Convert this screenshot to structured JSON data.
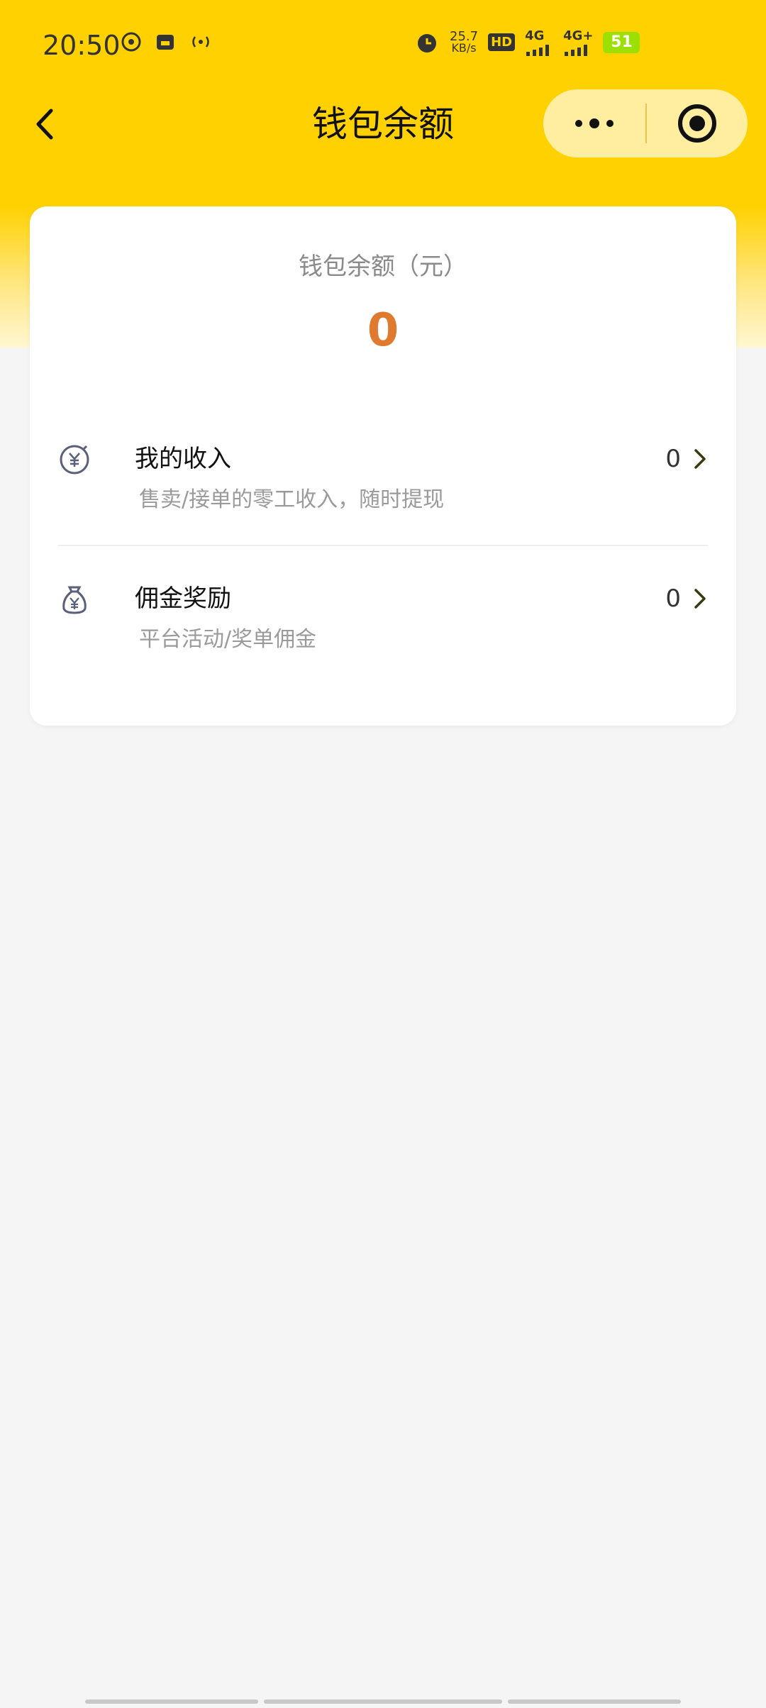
{
  "status_bar": {
    "time": "20:50",
    "net_speed_value": "25.7",
    "net_speed_unit": "KB/s",
    "hd_badge": "HD",
    "sim1_network": "4G",
    "sim2_network": "4G+",
    "battery_level": "51"
  },
  "nav": {
    "title": "钱包余额"
  },
  "card": {
    "balance_label": "钱包余额（元）",
    "balance_value": "0",
    "rows": [
      {
        "title": "我的收入",
        "subtitle": "售卖/接单的零工收入，随时提现",
        "value": "0",
        "icon": "yen-coin-icon"
      },
      {
        "title": "佣金奖励",
        "subtitle": "平台活动/奖单佣金",
        "value": "0",
        "icon": "money-bag-icon"
      }
    ]
  },
  "colors": {
    "header_yellow": "#FFD100",
    "balance_orange": "#E07A2E",
    "page_bg": "#f5f5f5"
  }
}
